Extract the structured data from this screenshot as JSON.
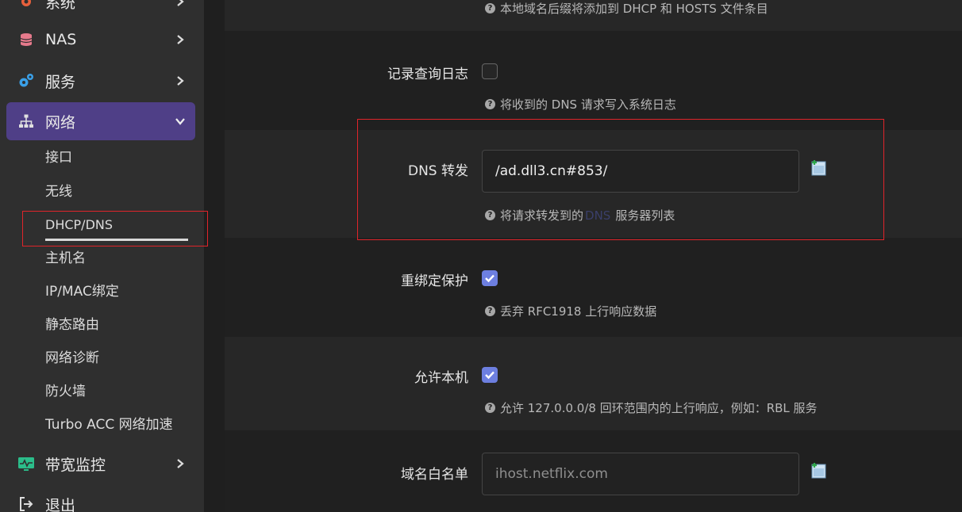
{
  "sidebar": {
    "items": [
      {
        "label": "系统",
        "icon": "gear-icon"
      },
      {
        "label": "NAS",
        "icon": "database-icon"
      },
      {
        "label": "服务",
        "icon": "cogs-icon"
      },
      {
        "label": "网络",
        "icon": "sitemap-icon"
      },
      {
        "label": "带宽监控",
        "icon": "monitor-icon"
      },
      {
        "label": "退出",
        "icon": "logout-icon"
      }
    ],
    "network_sub": [
      "接口",
      "无线",
      "DHCP/DNS",
      "主机名",
      "IP/MAC绑定",
      "静态路由",
      "网络诊断",
      "防火墙",
      "Turbo ACC 网络加速"
    ],
    "active_color": "#4f3f87"
  },
  "form": {
    "domain_suffix_help": "本地域名后缀将添加到 DHCP 和 HOSTS 文件条目",
    "log_queries": {
      "label": "记录查询日志",
      "help": "将收到的 DNS 请求写入系统日志",
      "checked": false
    },
    "dns_forward": {
      "label": "DNS 转发",
      "value": "/ad.dll3.cn#853/",
      "help_prefix": "将请求转发到的",
      "help_link": "DNS",
      "help_suffix": "服务器列表"
    },
    "rebind_protection": {
      "label": "重绑定保护",
      "help": "丢弃 RFC1918 上行响应数据",
      "checked": true
    },
    "allow_localhost": {
      "label": "允许本机",
      "help": "允许 127.0.0.0/8 回环范围内的上行响应，例如：RBL 服务",
      "checked": true
    },
    "domain_whitelist": {
      "label": "域名白名单",
      "placeholder": "ihost.netflix.com"
    }
  }
}
